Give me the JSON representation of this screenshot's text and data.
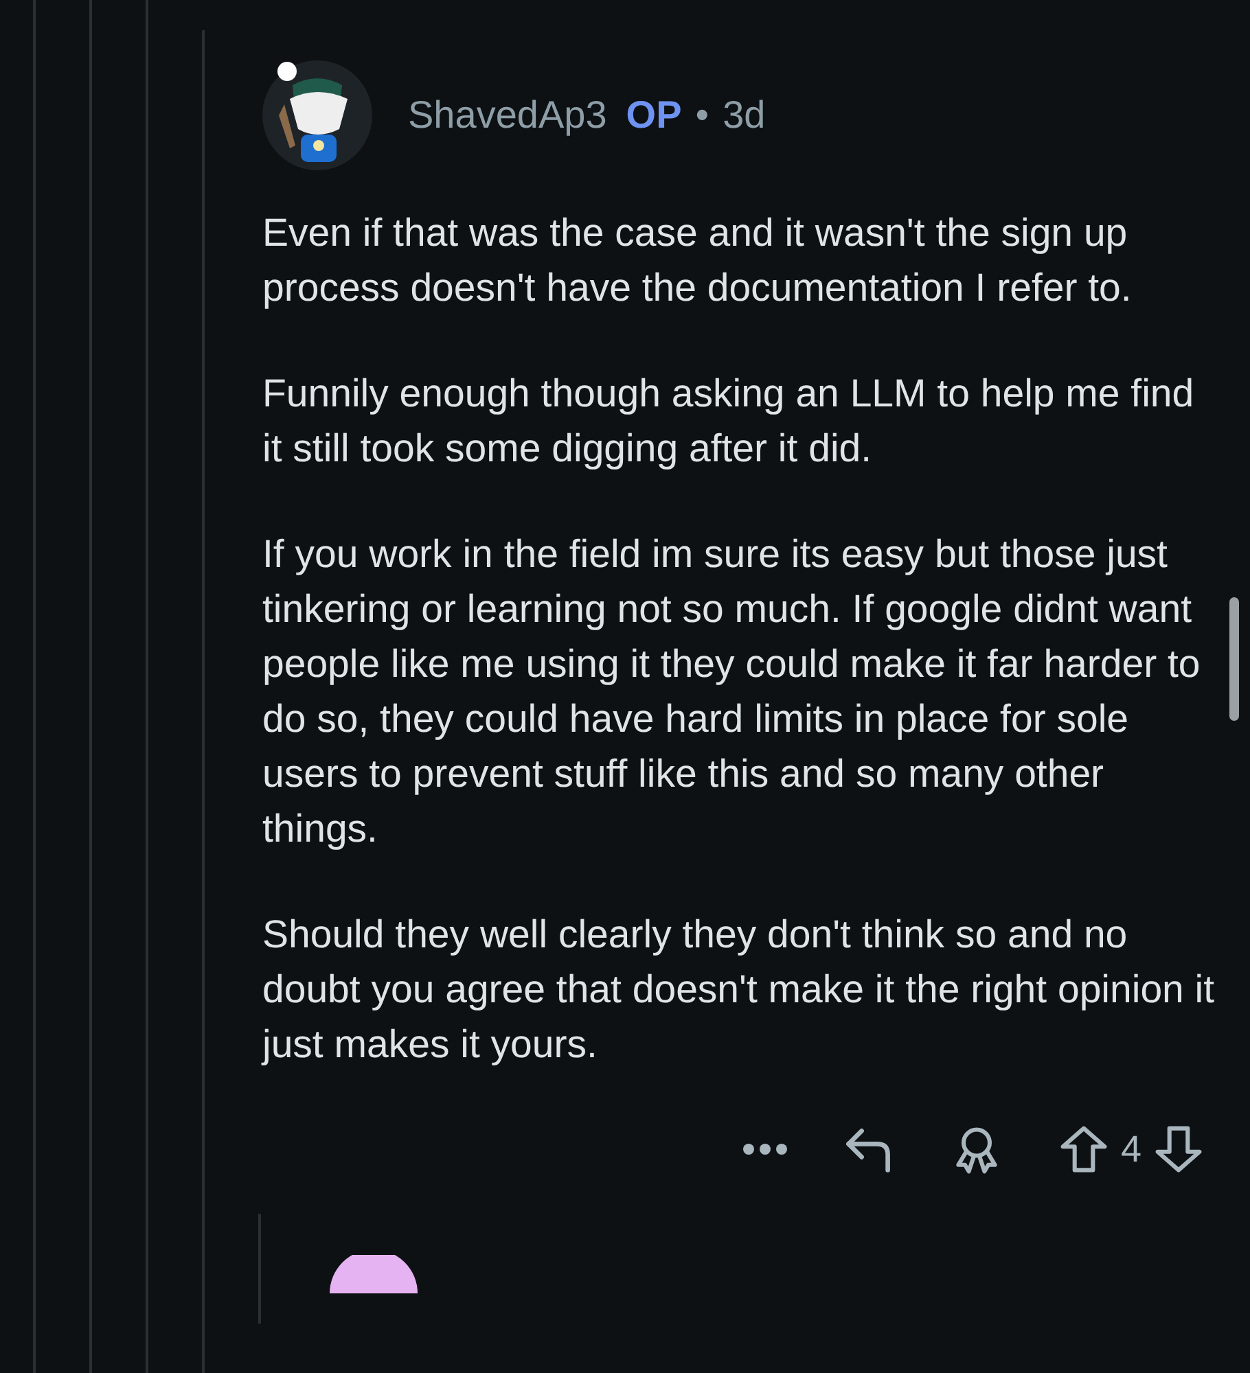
{
  "comment": {
    "author": "ShavedAp3",
    "op_badge": "OP",
    "separator": "•",
    "age": "3d",
    "paragraphs": [
      "Even if that was the case and it wasn't the sign up process doesn't have the documentation I refer to.",
      "Funnily enough though asking an LLM to help me find it still took some digging after it did.",
      "If you work in the field im sure its easy but those just tinkering or learning not so much. If google didnt want people like me using it they could make it far harder to do so, they could have hard limits in place for sole users to prevent stuff like this and so many other things.",
      "Should they well clearly they don't think so and no doubt you agree that doesn't make it the right opinion it just makes it yours."
    ],
    "score": "4"
  }
}
